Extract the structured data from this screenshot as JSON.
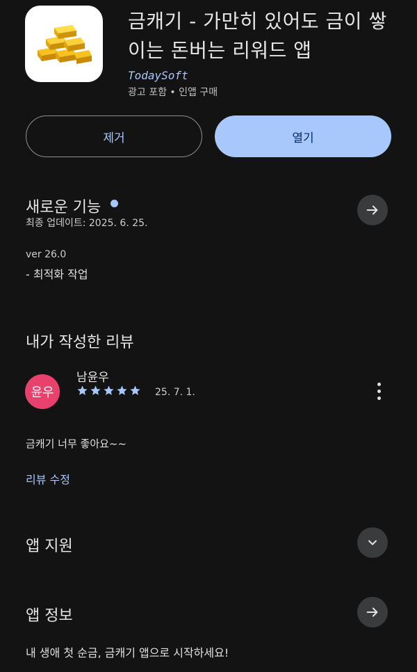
{
  "app": {
    "title": "금캐기 - 가만히 있어도 금이 쌓이는 돈버는 리워드 앱",
    "developer": "TodaySoft",
    "meta": "광고 포함 • 인앱 구매",
    "icon": "gold-bars-icon"
  },
  "buttons": {
    "remove_label": "제거",
    "open_label": "열기"
  },
  "whats_new": {
    "title": "새로운 기능",
    "updated": "최종 업데이트: 2025. 6. 25.",
    "version": "ver 26.0",
    "note": "- 최적화 작업"
  },
  "my_review": {
    "title": "내가 작성한 리뷰",
    "avatar_text": "윤우",
    "reviewer": "남윤우",
    "rating": 5,
    "date": "25. 7. 1.",
    "text": "금캐기 너무 좋아요~~",
    "edit_label": "리뷰 수정"
  },
  "app_support": {
    "title": "앱 지원"
  },
  "app_info": {
    "title": "앱 정보",
    "description": "내 생애 첫 순금, 금캐기 앱으로 시작하세요!"
  },
  "colors": {
    "background": "#131313",
    "accent": "#a8c7fa",
    "avatar": "#e8416d",
    "circle_button": "#3a3b3c"
  }
}
